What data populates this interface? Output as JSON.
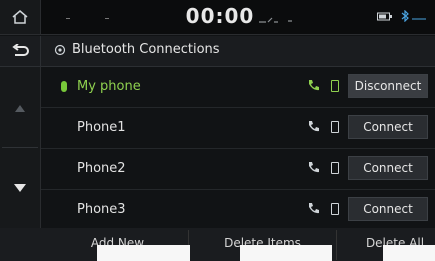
{
  "status_bar": {
    "time": "00:00"
  },
  "header": {
    "title": "Bluetooth Connections"
  },
  "devices": [
    {
      "name": "My phone",
      "action": "Disconnect",
      "connected": true
    },
    {
      "name": "Phone1",
      "action": "Connect",
      "connected": false
    },
    {
      "name": "Phone2",
      "action": "Connect",
      "connected": false
    },
    {
      "name": "Phone3",
      "action": "Connect",
      "connected": false
    }
  ],
  "tabs": [
    {
      "label": "Add New"
    },
    {
      "label": "Delete Items"
    },
    {
      "label": "Delete All"
    }
  ],
  "colors": {
    "accent_green": "#8fd14f",
    "background": "#111315"
  },
  "icons": [
    "home-icon",
    "back-icon",
    "bluetooth-settings-icon",
    "scroll-up-icon",
    "scroll-down-icon",
    "phone-icon",
    "message-icon",
    "bluetooth-status-icon"
  ]
}
